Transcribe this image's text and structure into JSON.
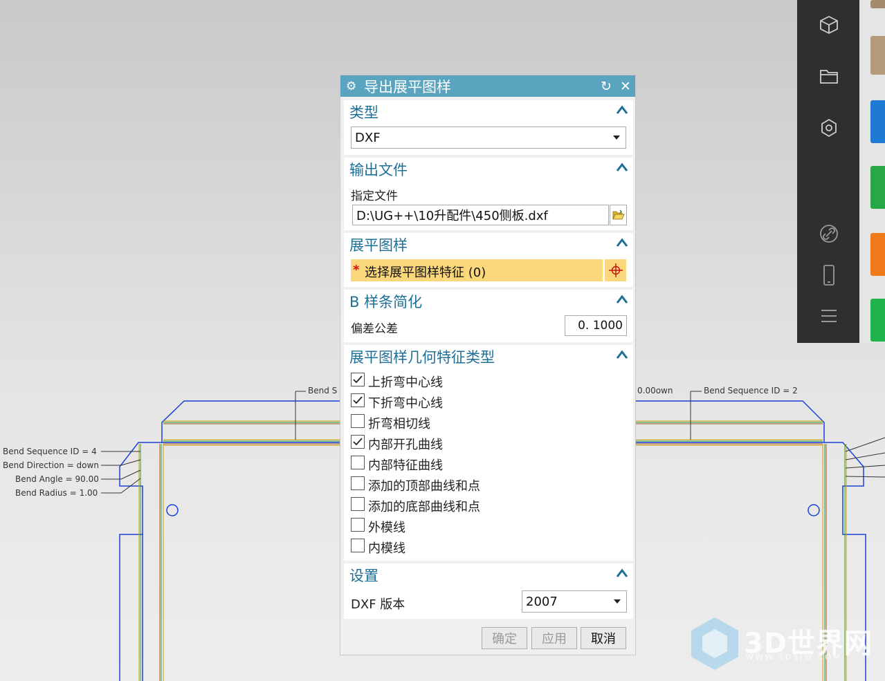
{
  "dialog": {
    "title": "导出展平图样",
    "refresh_icon": "refresh-icon",
    "close_icon": "close-icon",
    "type_section": {
      "header": "类型",
      "value": "DXF"
    },
    "output_section": {
      "header": "输出文件",
      "file_label": "指定文件",
      "file_path": "D:\\UG++\\10升配件\\450侧板.dxf"
    },
    "flat_section": {
      "header": "展平图样",
      "required_mark": "*",
      "select_label": "选择展平图样特征 (0)"
    },
    "spline_section": {
      "header": "B 样条简化",
      "tolerance_label": "偏差公差",
      "tolerance_value": "0. 1000"
    },
    "geometry_section": {
      "header": "展平图样几何特征类型",
      "items": [
        {
          "label": "上折弯中心线",
          "checked": true
        },
        {
          "label": "下折弯中心线",
          "checked": true
        },
        {
          "label": "折弯相切线",
          "checked": false
        },
        {
          "label": "内部开孔曲线",
          "checked": true
        },
        {
          "label": "内部特征曲线",
          "checked": false
        },
        {
          "label": "添加的顶部曲线和点",
          "checked": false
        },
        {
          "label": "添加的底部曲线和点",
          "checked": false
        },
        {
          "label": "外模线",
          "checked": false
        },
        {
          "label": "内模线",
          "checked": false
        }
      ]
    },
    "settings_section": {
      "header": "设置",
      "version_label": "DXF 版本",
      "version_value": "2007"
    },
    "buttons": {
      "ok": "确定",
      "apply": "应用",
      "cancel": "取消"
    }
  },
  "drawing": {
    "left_annotations": [
      "Bend Sequence ID = 4",
      "Bend Direction = down",
      "Bend Angle = 90.00",
      "Bend Radius = 1.00"
    ],
    "top_left_annotation": "Bend S",
    "top_right_annotation_a": "0.00own",
    "top_right_annotation_b": "Bend Sequence ID = 2",
    "line_color": "#1a3fd6"
  },
  "sidebar": {
    "icons": [
      "cube-icon",
      "folder-icon",
      "component-icon",
      "link-icon",
      "phone-icon",
      "menu-icon"
    ]
  },
  "watermark": {
    "title": "3D世界网",
    "subtitle": "WWW.3DSJW.COM"
  }
}
